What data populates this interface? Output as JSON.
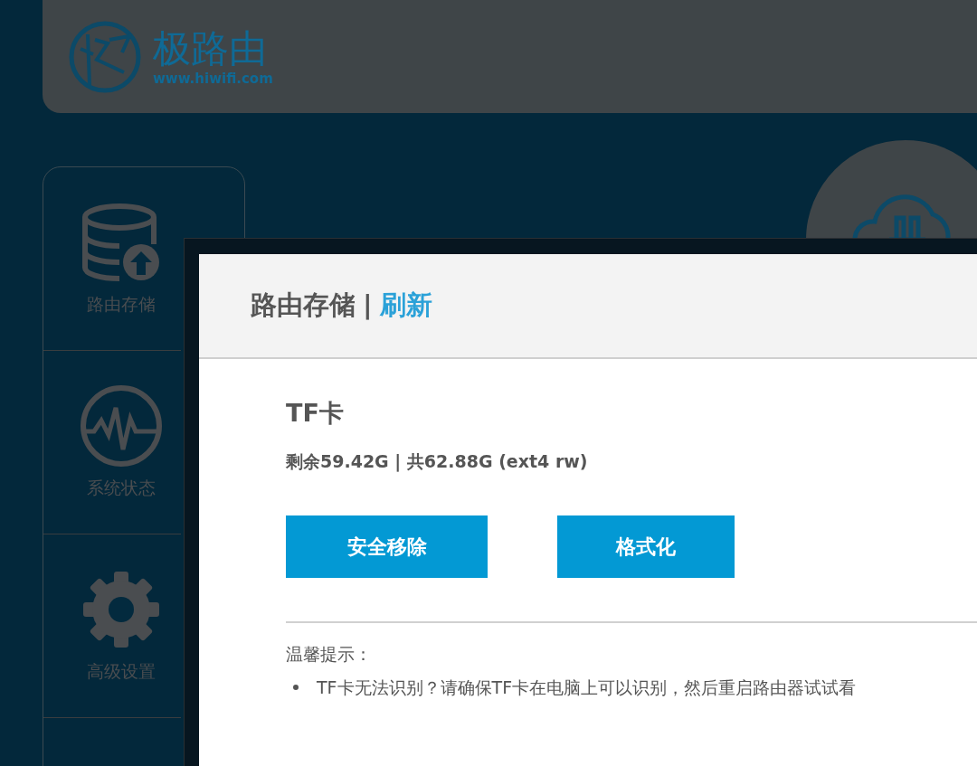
{
  "header": {
    "logo_text": "极路由",
    "logo_url": "www.hiwifi.com"
  },
  "sidebar": {
    "items": [
      {
        "label": "路由存储",
        "kind": "storage"
      },
      {
        "label": "系统状态",
        "kind": "status"
      },
      {
        "label": "高级设置",
        "kind": "settings"
      }
    ]
  },
  "dialog": {
    "title": "路由存储",
    "separator": "|",
    "refresh_link": "刷新",
    "device": {
      "name": "TF卡",
      "usage": "剩余59.42G | 共62.88G (ext4 rw)"
    },
    "buttons": [
      "安全移除",
      "格式化"
    ],
    "tips": {
      "heading": "温馨提示：",
      "items": [
        "TF卡无法识别？请确保TF卡在电脑上可以识别，然后重启路由器试试看"
      ]
    }
  }
}
